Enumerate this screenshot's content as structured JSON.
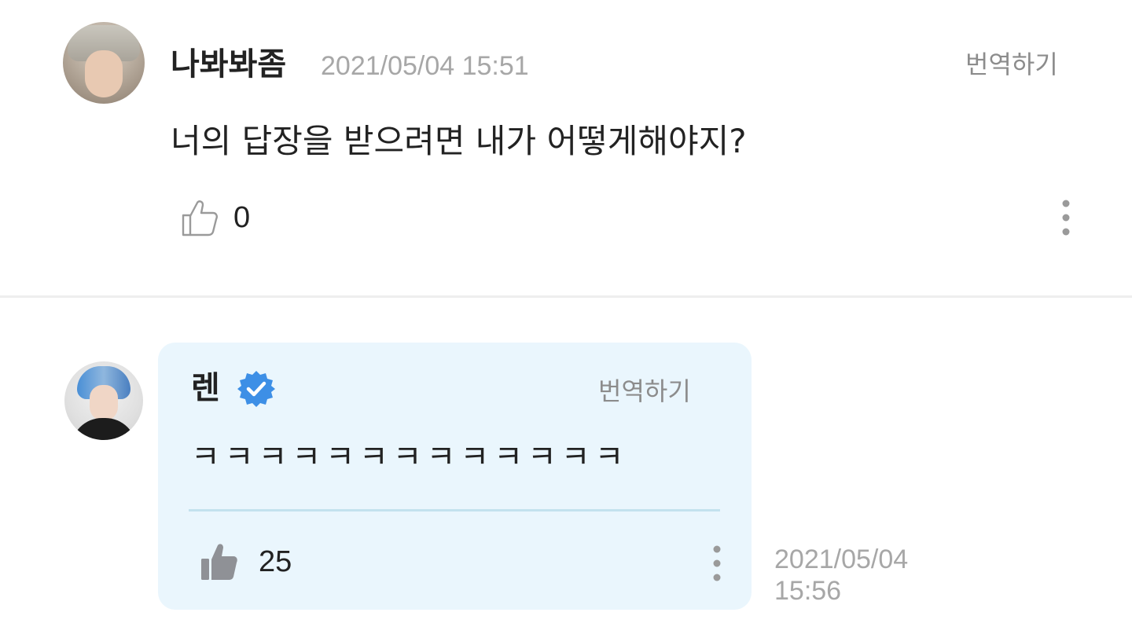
{
  "comments": [
    {
      "username": "나봐봐좀",
      "timestamp": "2021/05/04 15:51",
      "translate_label": "번역하기",
      "text": "너의 답장을 받으려면 내가 어떻게해야지?",
      "like_count": "0",
      "liked": false,
      "avatar_icon": "user-avatar-photo"
    }
  ],
  "reply": {
    "username": "렌",
    "verified": true,
    "verified_color": "#3d8fe6",
    "translate_label": "번역하기",
    "text": "ㅋㅋㅋㅋㅋㅋㅋㅋㅋㅋㅋㅋㅋ",
    "like_count": "25",
    "liked": true,
    "timestamp_date": "2021/05/04",
    "timestamp_time": "15:56",
    "card_background": "#eaf6fd",
    "avatar_icon": "artist-avatar-photo"
  },
  "colors": {
    "text_primary": "#222222",
    "text_muted": "#a7a7a7",
    "translate": "#8c8c8c",
    "divider": "#eeeeee",
    "card_divider": "#c3e2ee",
    "like_filled": "#8f9196",
    "like_outline": "#9a9a9a"
  },
  "icons": {
    "like_outline": "thumbs-up-outline-icon",
    "like_filled": "thumbs-up-filled-icon",
    "more": "more-vertical-icon",
    "verified": "verified-badge-icon"
  }
}
